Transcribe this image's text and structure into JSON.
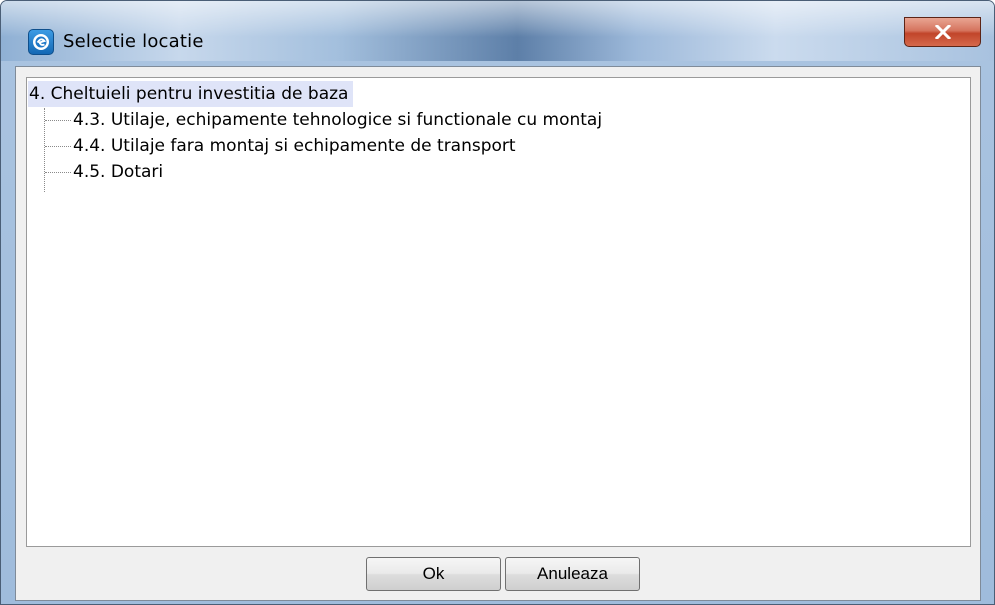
{
  "window": {
    "title": "Selectie locatie",
    "icon": "app-logo-icon",
    "close_icon": "close-icon",
    "accent": "#1468b4",
    "close_color": "#c1452a"
  },
  "tree": {
    "root": {
      "label": "4. Cheltuieli pentru investitia de baza",
      "selected": true
    },
    "children": [
      {
        "label": "4.3. Utilaje, echipamente tehnologice si functionale cu montaj"
      },
      {
        "label": "4.4. Utilaje fara montaj si echipamente de transport"
      },
      {
        "label": "4.5. Dotari"
      }
    ],
    "selection_color": "#dfe4f8"
  },
  "buttons": {
    "ok_label": "Ok",
    "cancel_label": "Anuleaza"
  }
}
